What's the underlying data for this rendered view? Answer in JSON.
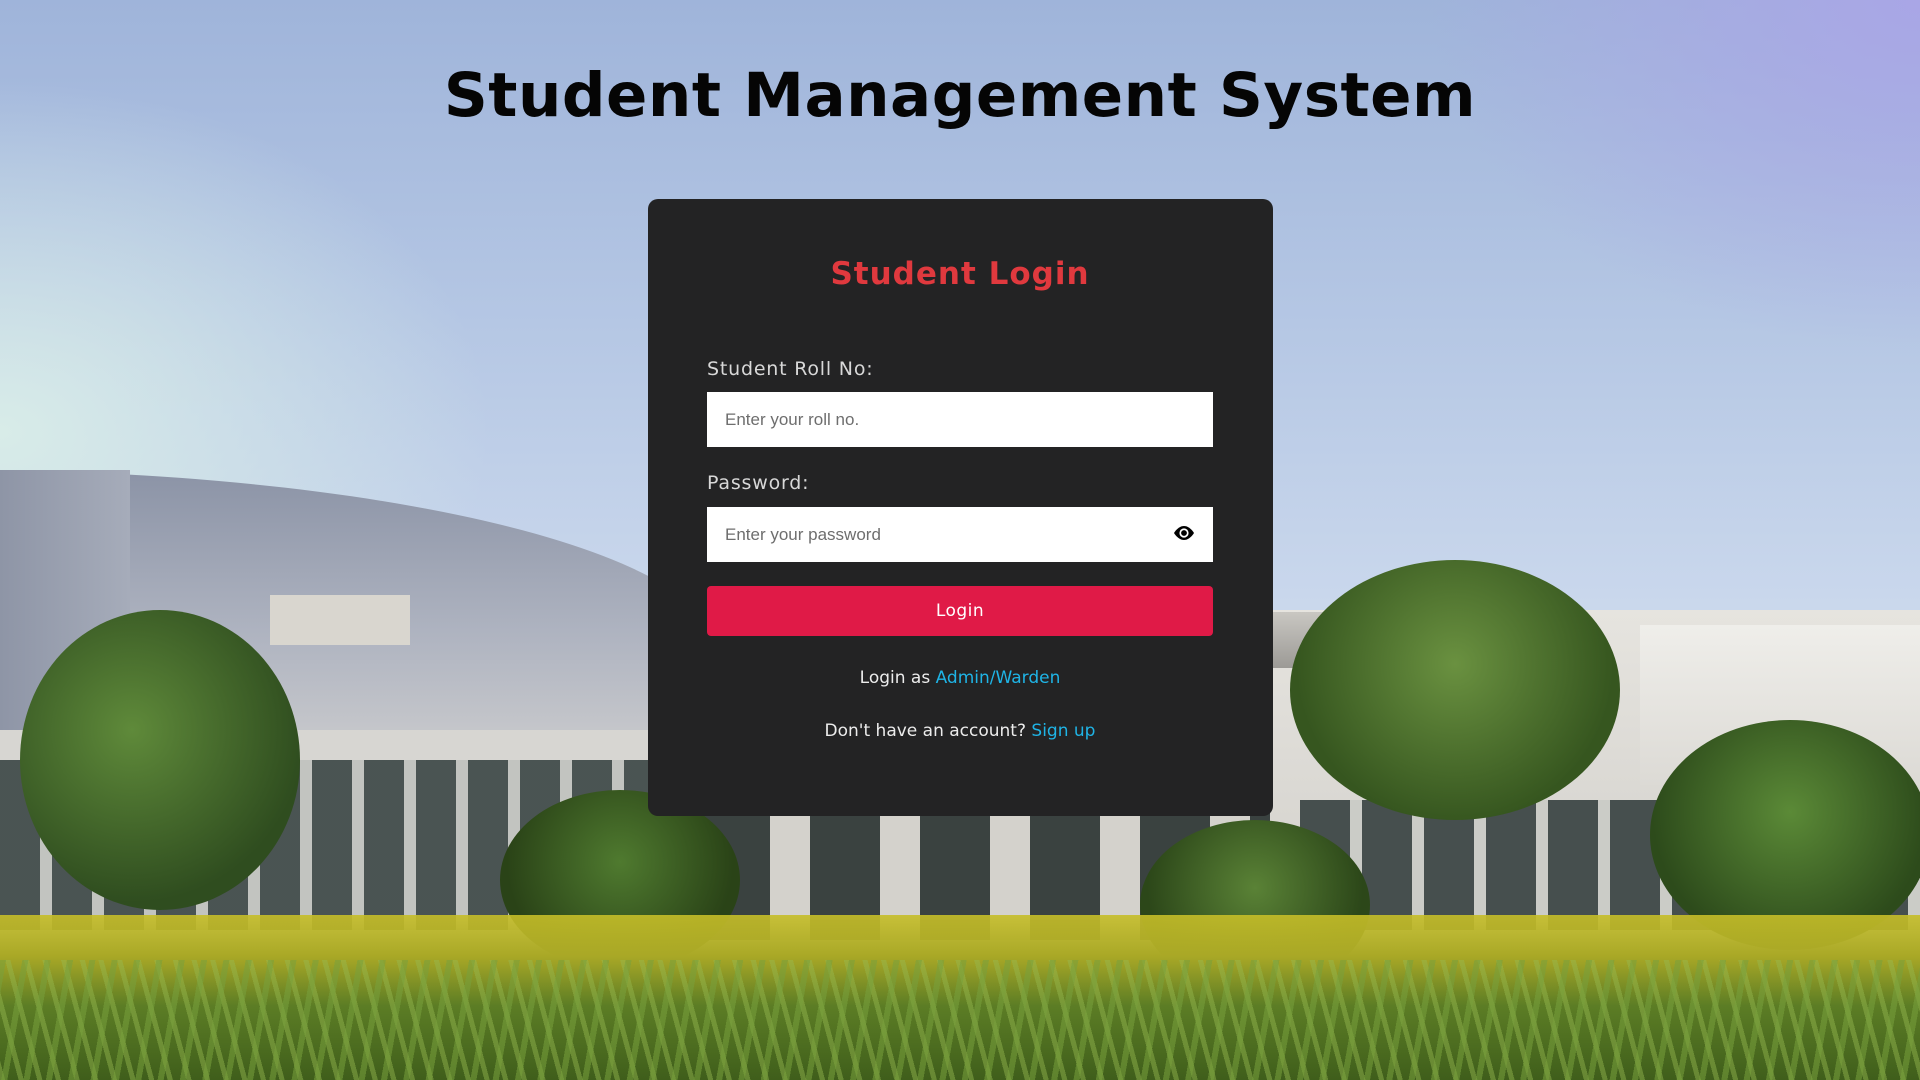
{
  "page": {
    "title": "Student Management System"
  },
  "login_card": {
    "title": "Student Login",
    "roll_no": {
      "label": "Student Roll No:",
      "placeholder": "Enter your roll no.",
      "value": ""
    },
    "password": {
      "label": "Password:",
      "placeholder": "Enter your password",
      "value": "",
      "toggle_icon": "eye-icon"
    },
    "login_button": "Login",
    "admin_prompt": "Login as ",
    "admin_link": "Admin/Warden",
    "signup_prompt": "Don't have an account? ",
    "signup_link": "Sign up"
  },
  "colors": {
    "card_background": "#232324",
    "title_accent": "#e0393e",
    "button": "#e01a47",
    "link": "#1fb4e6"
  }
}
